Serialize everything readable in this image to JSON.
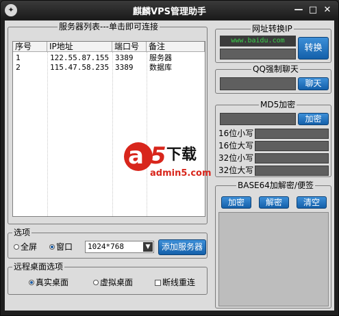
{
  "window": {
    "title": "麒麟VPS管理助手",
    "icon": "app-icon",
    "minimize": "—",
    "maximize": "□",
    "close": "✕"
  },
  "servers": {
    "group_label": "服务器列表---单击即可连接",
    "columns": [
      "序号",
      "IP地址",
      "端口号",
      "备注"
    ],
    "rows": [
      [
        "1",
        "122.55.87.155",
        "3389",
        "服务器"
      ],
      [
        "2",
        "115.47.58.235",
        "3389",
        "数据库"
      ]
    ]
  },
  "options": {
    "group_label": "选项",
    "fullscreen_label": "全屏",
    "window_label": "窗口",
    "window_checked": true,
    "resolution_value": "1024*768",
    "add_server_label": "添加服务器"
  },
  "remote": {
    "group_label": "远程桌面选项",
    "real_desktop_label": "真实桌面",
    "real_desktop_checked": true,
    "virtual_desktop_label": "虚拟桌面",
    "reconnect_label": "断线重连"
  },
  "url_to_ip": {
    "group_label": "网址转换IP",
    "url_value": "www.baidu.com",
    "convert_label": "转换"
  },
  "qq_chat": {
    "group_label": "QQ强制聊天",
    "chat_label": "聊天"
  },
  "md5": {
    "group_label": "MD5加密",
    "encrypt_label": "加密",
    "outputs": [
      "16位小写",
      "16位大写",
      "32位小写",
      "32位大写"
    ]
  },
  "base64": {
    "group_label": "BASE64加解密/便签",
    "encrypt_label": "加密",
    "decrypt_label": "解密",
    "clear_label": "清空"
  },
  "watermark": {
    "brand_letter": "a",
    "brand_digit": "5",
    "brand_suffix": "下载",
    "site": "admin5.com"
  },
  "colors": {
    "accent": "#1a6cc0",
    "title_bg": "#1f1f1f",
    "panel_bg": "#dcdcdc",
    "watermark_red": "#d8261c"
  }
}
